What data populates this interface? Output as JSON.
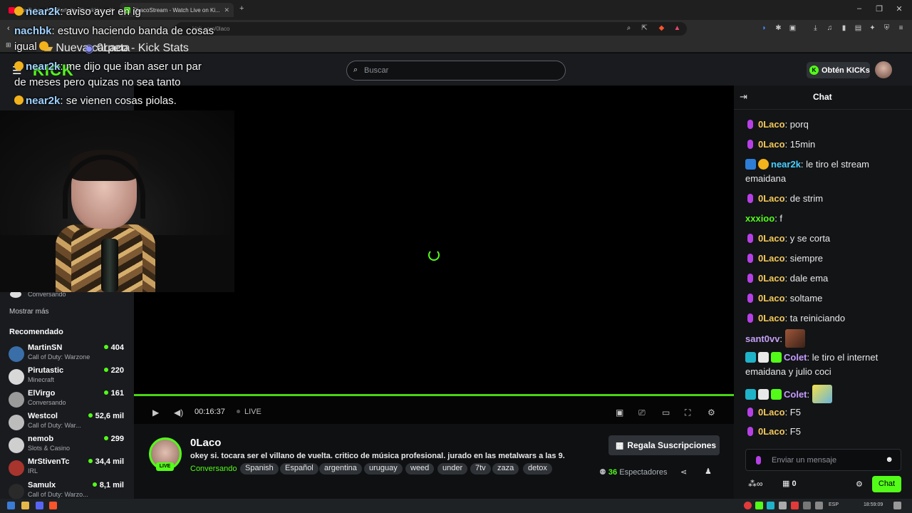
{
  "browser": {
    "tabs": [
      {
        "label": "YouTube - Anti Fortnite ZikzakYou Gr...",
        "active": false
      },
      {
        "label": "0LacoStream - Watch Live on Ki...",
        "active": true
      }
    ],
    "new_tab": "+",
    "url": "kick.com/0laco",
    "bookmarks": [
      "Nueva carpeta",
      "0Laco - Kick Stats"
    ]
  },
  "kick": {
    "logo": "KICK",
    "search_placeholder": "Buscar",
    "get_kicks": "Obtén KICKs"
  },
  "overlay_chat": [
    {
      "user": "near2k",
      "text": ": aviso ayer en ig"
    },
    {
      "user": "nachbk",
      "text": ": estuvo haciendo banda de cosas"
    },
    {
      "user": "",
      "text": "igual"
    },
    {
      "user": "near2k",
      "text": ": me dijo que iban aser un par"
    },
    {
      "user": "",
      "text": "de meses pero quizas no sea tanto"
    },
    {
      "user": "near2k",
      "text": ": se vienen cosas piolas."
    }
  ],
  "sidebar": {
    "partial_item_category": "Conversando",
    "show_more": "Mostrar más",
    "recommended_heading": "Recomendado",
    "recommended": [
      {
        "name": "MartinSN",
        "category": "Call of Duty: Warzone",
        "viewers": "404",
        "color": "#3a6ea8"
      },
      {
        "name": "Pirutastic",
        "category": "Minecraft",
        "viewers": "220",
        "color": "#d8d8d8"
      },
      {
        "name": "ElVirgo",
        "category": "Conversando",
        "viewers": "161",
        "color": "#9a9a9a"
      },
      {
        "name": "Westcol",
        "category": "Call of Duty: War...",
        "viewers": "52,6 mil",
        "color": "#bcbcbc"
      },
      {
        "name": "nemob",
        "category": "Slots & Casino",
        "viewers": "299",
        "color": "#cfcfcf"
      },
      {
        "name": "MrStivenTc",
        "category": "IRL",
        "viewers": "34,4 mil",
        "color": "#a8342e"
      },
      {
        "name": "Samulx",
        "category": "Call of Duty: Warzo...",
        "viewers": "8,1 mil",
        "color": "#2a2a2a"
      }
    ]
  },
  "player": {
    "elapsed": "00:16:37",
    "live_label": "LIVE"
  },
  "channel": {
    "name": "0Laco",
    "live_badge": "LIVE",
    "title": "okey si. tocara ser el villano de vuelta. critico de música profesional. jurado en las metalwars a las 9.",
    "category": "Conversando",
    "tags": [
      "Spanish",
      "Español",
      "argentina",
      "uruguay",
      "weed",
      "under",
      "7tv",
      "zaza",
      "detox"
    ],
    "subs_button": "Regala Suscripciones",
    "viewers_count": "36",
    "viewers_label": "Espectadores"
  },
  "chat": {
    "title": "Chat",
    "messages": [
      {
        "user": "0Laco",
        "text": ": porq"
      },
      {
        "user": "0Laco",
        "text": ": 15min"
      },
      {
        "user": "near2k",
        "text": ": le tiro el stream emaidana"
      },
      {
        "user": "0Laco",
        "text": ": de strim"
      },
      {
        "user": "xxxioo",
        "text": ": f"
      },
      {
        "user": "0Laco",
        "text": ": y se corta"
      },
      {
        "user": "0Laco",
        "text": ": siempre"
      },
      {
        "user": "0Laco",
        "text": ": dale ema"
      },
      {
        "user": "0Laco",
        "text": ": soltame"
      },
      {
        "user": "0Laco",
        "text": ": ta reiniciando"
      },
      {
        "user": "sant0vv",
        "text": ":"
      },
      {
        "user": "Colet",
        "text": ": le tiro el internet emaidana y julio coci"
      },
      {
        "user": "Colet",
        "text": ":"
      },
      {
        "user": "0Laco",
        "text": ": F5"
      },
      {
        "user": "0Laco",
        "text": ": F5"
      }
    ],
    "input_placeholder": "Enviar un mensaje",
    "kicks_count": "0",
    "send_label": "Chat"
  },
  "taskbar": {
    "lang": "ESP",
    "clock": "18:59:09"
  },
  "colors": {
    "accent": "#53fc18",
    "bg": "#0b0e0f"
  }
}
